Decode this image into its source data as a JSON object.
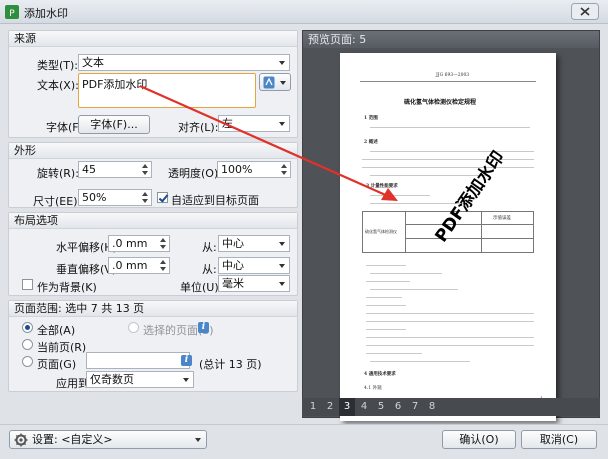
{
  "window": {
    "title": "添加水印",
    "close_icon": "close-icon"
  },
  "source": {
    "header": "来源",
    "type_label": "类型(T):",
    "type_value": "文本",
    "text_label": "文本(X):",
    "text_value": "PDF添加水印",
    "font_label": "字体(F):",
    "font_button": "字体(F)...",
    "align_label": "对齐(L):",
    "align_value": "左"
  },
  "appearance": {
    "header": "外形",
    "rotation_label": "旋转(R):",
    "rotation_value": "45",
    "opacity_label": "透明度(O):",
    "opacity_value": "100%",
    "size_label": "尺寸(EE):",
    "size_value": "50%",
    "fit_label": "自适应到目标页面",
    "fit_checked": true
  },
  "layout": {
    "header": "布局选项",
    "h_offset_label": "水平偏移(H):",
    "h_offset_value": ".0 mm",
    "h_from_label": "从:",
    "h_from_value": "中心",
    "v_offset_label": "垂直偏移(V):",
    "v_offset_value": ".0 mm",
    "v_from_label": "从:",
    "v_from_value": "中心",
    "background_label": "作为背景(K)",
    "background_checked": false,
    "unit_label": "单位(U):",
    "unit_value": "毫米"
  },
  "page_range": {
    "header": "页面范围: 选中 7 共 13 页",
    "all_label": "全部(A)",
    "selected_label": "选择的页面(S)",
    "current_label": "当前页(R)",
    "pages_label": "页面(G)",
    "total_label": "(总计 13 页)",
    "apply_label": "应用到:",
    "apply_value": "仅奇数页",
    "selected_option": "all"
  },
  "preview": {
    "header": "预览页面: 5",
    "watermark_text": "PDF添加水印",
    "doc": {
      "code": "JJG 693—2003",
      "title": "硫化氢气体检测仪检定规程",
      "s1": "1  范围",
      "s2": "2  概述",
      "s3": "3  计量性能要求",
      "table_header": "示值误差",
      "table_row": "硫化氢气体检测仪",
      "s4": "4  通用技术要求",
      "s41": "4.1  外观",
      "page_num": "1"
    },
    "pages": [
      "1",
      "2",
      "3",
      "4",
      "5",
      "6",
      "7",
      "8"
    ],
    "active_page": "3"
  },
  "bottom": {
    "settings_label": "设置: <自定义>",
    "ok_label": "确认(O)",
    "cancel_label": "取消(C)"
  },
  "colors": {
    "accent": "#1d4b8f",
    "textarea_border": "#e2a640",
    "arrow": "#e0312b",
    "preview_bg": "#4f5358"
  }
}
